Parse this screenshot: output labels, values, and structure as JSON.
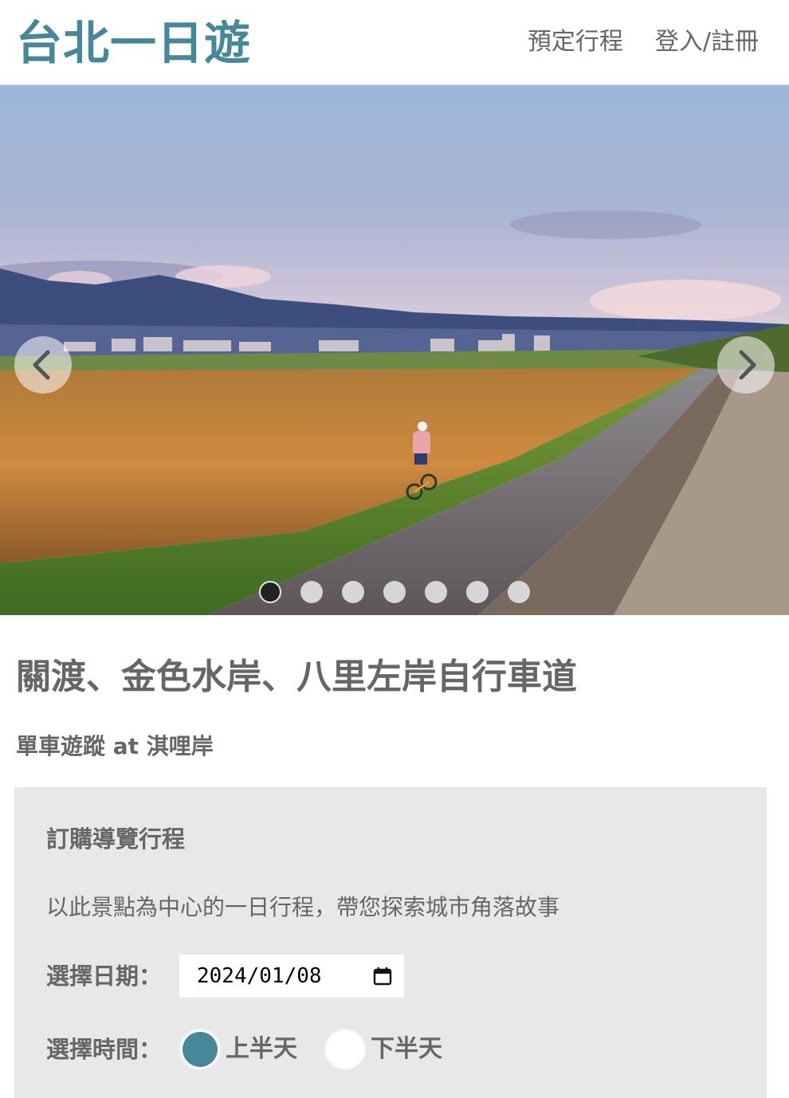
{
  "navbar": {
    "brand": "台北一日遊",
    "links": [
      "預定行程",
      "登入/註冊"
    ]
  },
  "carousel": {
    "slide_count": 7,
    "active_index": 0,
    "image_description_icon": "photo"
  },
  "attraction": {
    "title": "關渡、金色水岸、八里左岸自行車道",
    "subtitle": "單車遊蹤 at 淇哩岸"
  },
  "booking": {
    "heading": "訂購導覽行程",
    "description": "以此景點為中心的一日行程，帶您探索城市角落故事",
    "date_label": "選擇日期：",
    "date_value": "2024/01/08",
    "time_label": "選擇時間：",
    "time_options": [
      "上半天",
      "下半天"
    ],
    "selected_time": "上半天"
  },
  "colors": {
    "brand": "#448899",
    "text": "#666666",
    "panel": "#e8e8e8"
  }
}
